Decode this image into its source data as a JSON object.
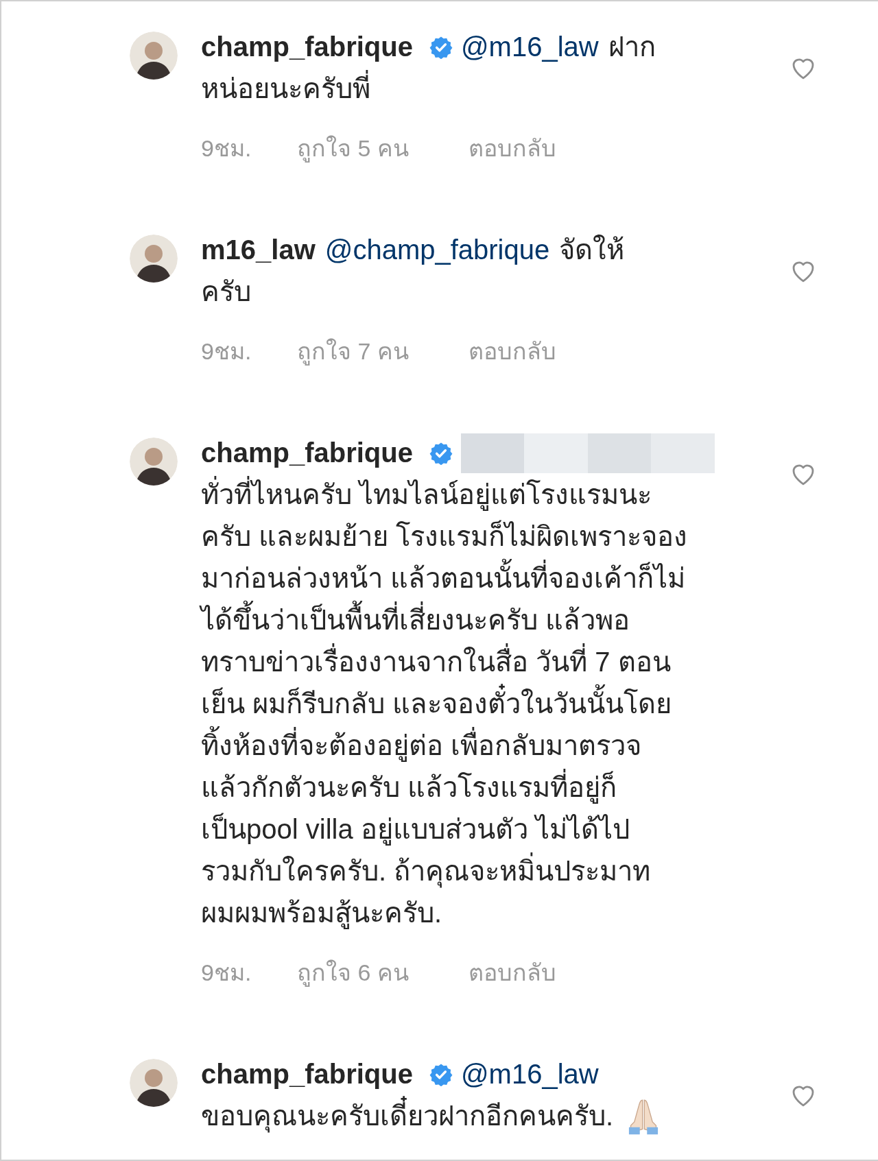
{
  "comments": [
    {
      "username": "champ_fabrique",
      "verified": true,
      "mention": "@m16_law",
      "mention_redacted": false,
      "head_text": "ฝาก",
      "lines": [
        "หน่อยนะครับพี่"
      ],
      "trailing_emoji": false,
      "time": "9ชม.",
      "likes": "ถูกใจ 5 คน",
      "reply": "ตอบกลับ",
      "liked": false
    },
    {
      "username": "m16_law",
      "verified": false,
      "mention": "@champ_fabrique",
      "mention_redacted": false,
      "head_text": "จัดให้",
      "lines": [
        "ครับ"
      ],
      "trailing_emoji": false,
      "time": "9ชม.",
      "likes": "ถูกใจ 7 คน",
      "reply": "ตอบกลับ",
      "liked": false
    },
    {
      "username": "champ_fabrique",
      "verified": true,
      "mention_redacted": true,
      "lines": [
        "ทั่วที่ไหนครับ ไทมไลน์อยู่แต่โรงแรมนะ",
        "ครับ และผมย้าย โรงแรมก็ไม่ผิดเพราะจอง",
        "มาก่อนล่วงหน้า แล้วตอนนั้นที่จองเค้าก็ไม่",
        "ได้ขึ้นว่าเป็นพื้นที่เสี่ยงนะครับ แล้วพอ",
        "ทราบข่าวเรื่องงานจากในสื่อ วันที่ 7 ตอน",
        "เย็น ผมก็รีบกลับ และจองตั๋วในวันนั้นโดย",
        "ทิ้งห้องที่จะต้องอยู่ต่อ เพื่อกลับมาตรวจ",
        "แล้วกักตัวนะครับ แล้วโรงแรมที่อยู่ก็",
        "เป็นpool villa อยู่แบบส่วนตัว ไม่ได้ไป",
        "รวมกับใครครับ. ถ้าคุณจะหมิ่นประมาท",
        "ผมผมพร้อมสู้นะครับ."
      ],
      "trailing_emoji": false,
      "time": "9ชม.",
      "likes": "ถูกใจ 6 คน",
      "reply": "ตอบกลับ",
      "liked": false
    },
    {
      "username": "champ_fabrique",
      "verified": true,
      "mention": "@m16_law",
      "mention_redacted": false,
      "lines": [
        "ขอบคุณนะครับเดี๋ยวฝากอีกคนครับ."
      ],
      "trailing_emoji": true,
      "liked": false
    }
  ]
}
